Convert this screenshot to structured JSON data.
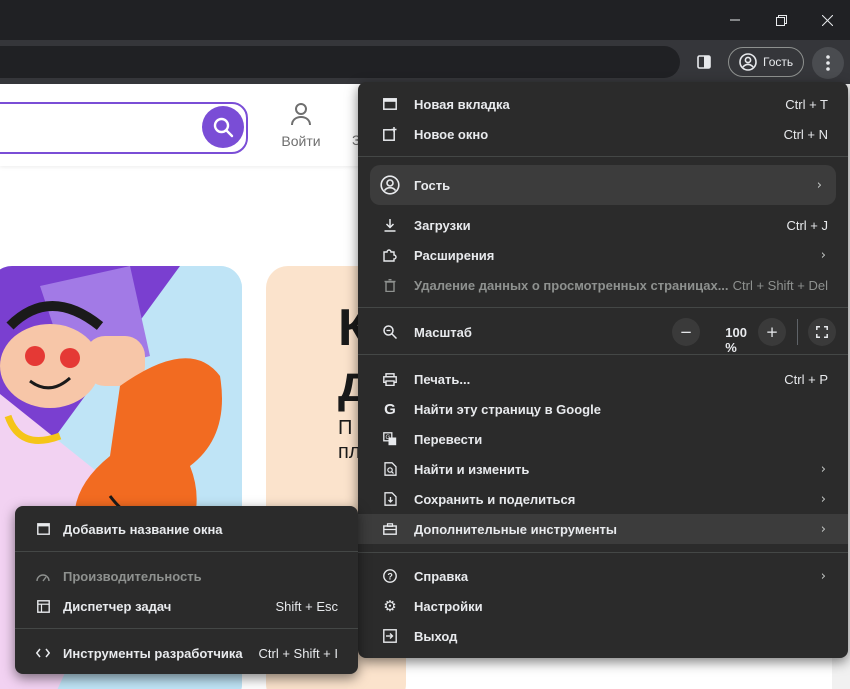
{
  "toolbar": {
    "profile_label": "Гость"
  },
  "page": {
    "login_label": "Войти",
    "header_next": "З",
    "promo2_big": "К\nд",
    "promo2_small": "П\nпл"
  },
  "main_menu": {
    "new_tab": {
      "label": "Новая вкладка",
      "shortcut": "Ctrl + T"
    },
    "new_window": {
      "label": "Новое окно",
      "shortcut": "Ctrl + N"
    },
    "guest": {
      "label": "Гость"
    },
    "downloads": {
      "label": "Загрузки",
      "shortcut": "Ctrl + J"
    },
    "extensions": {
      "label": "Расширения"
    },
    "clear_data": {
      "label": "Удаление данных о просмотренных страницах...",
      "shortcut": "Ctrl + Shift + Del"
    },
    "zoom": {
      "label": "Масштаб",
      "value": "100 %",
      "minus": "−",
      "plus": "+"
    },
    "print": {
      "label": "Печать...",
      "shortcut": "Ctrl + P"
    },
    "find_google": {
      "label": "Найти эту страницу в Google"
    },
    "translate": {
      "label": "Перевести"
    },
    "find_edit": {
      "label": "Найти и изменить"
    },
    "save_share": {
      "label": "Сохранить и поделиться"
    },
    "more_tools": {
      "label": "Дополнительные инструменты"
    },
    "help": {
      "label": "Справка"
    },
    "settings": {
      "label": "Настройки"
    },
    "exit": {
      "label": "Выход"
    }
  },
  "sub_menu": {
    "name_window": {
      "label": "Добавить название окна"
    },
    "performance": {
      "label": "Производительность"
    },
    "task_manager": {
      "label": "Диспетчер задач",
      "shortcut": "Shift + Esc"
    },
    "dev_tools": {
      "label": "Инструменты разработчика",
      "shortcut": "Ctrl + Shift + I"
    }
  },
  "colors": {
    "menu_bg": "#2b2b2b",
    "accent": "#7a4dd6",
    "toolbar": "#35363a"
  }
}
